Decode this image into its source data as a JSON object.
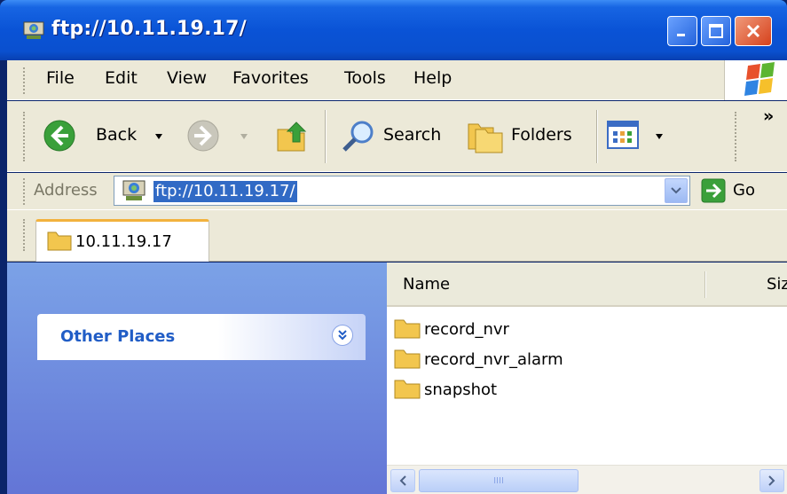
{
  "window": {
    "title": "ftp://10.11.19.17/"
  },
  "menu": {
    "items": [
      "File",
      "Edit",
      "View",
      "Favorites",
      "Tools",
      "Help"
    ]
  },
  "toolbar": {
    "back_label": "Back",
    "search_label": "Search",
    "folders_label": "Folders",
    "overflow": "»"
  },
  "address": {
    "label": "Address",
    "value": "ftp://10.11.19.17/",
    "go_label": "Go"
  },
  "tab": {
    "label": "10.11.19.17"
  },
  "taskpane": {
    "other_places_title": "Other Places"
  },
  "filelist": {
    "columns": {
      "name": "Name",
      "size": "Siz"
    },
    "items": [
      "record_nvr",
      "record_nvr_alarm",
      "snapshot"
    ]
  },
  "scrollbar": {
    "thumb_grip": "IIII"
  },
  "colors": {
    "titlebar": "#0a53d6",
    "selection": "#316ac5",
    "taskpane_top": "#7ba2e7",
    "taskpane_bottom": "#6375d6",
    "link_title": "#215dc6"
  }
}
